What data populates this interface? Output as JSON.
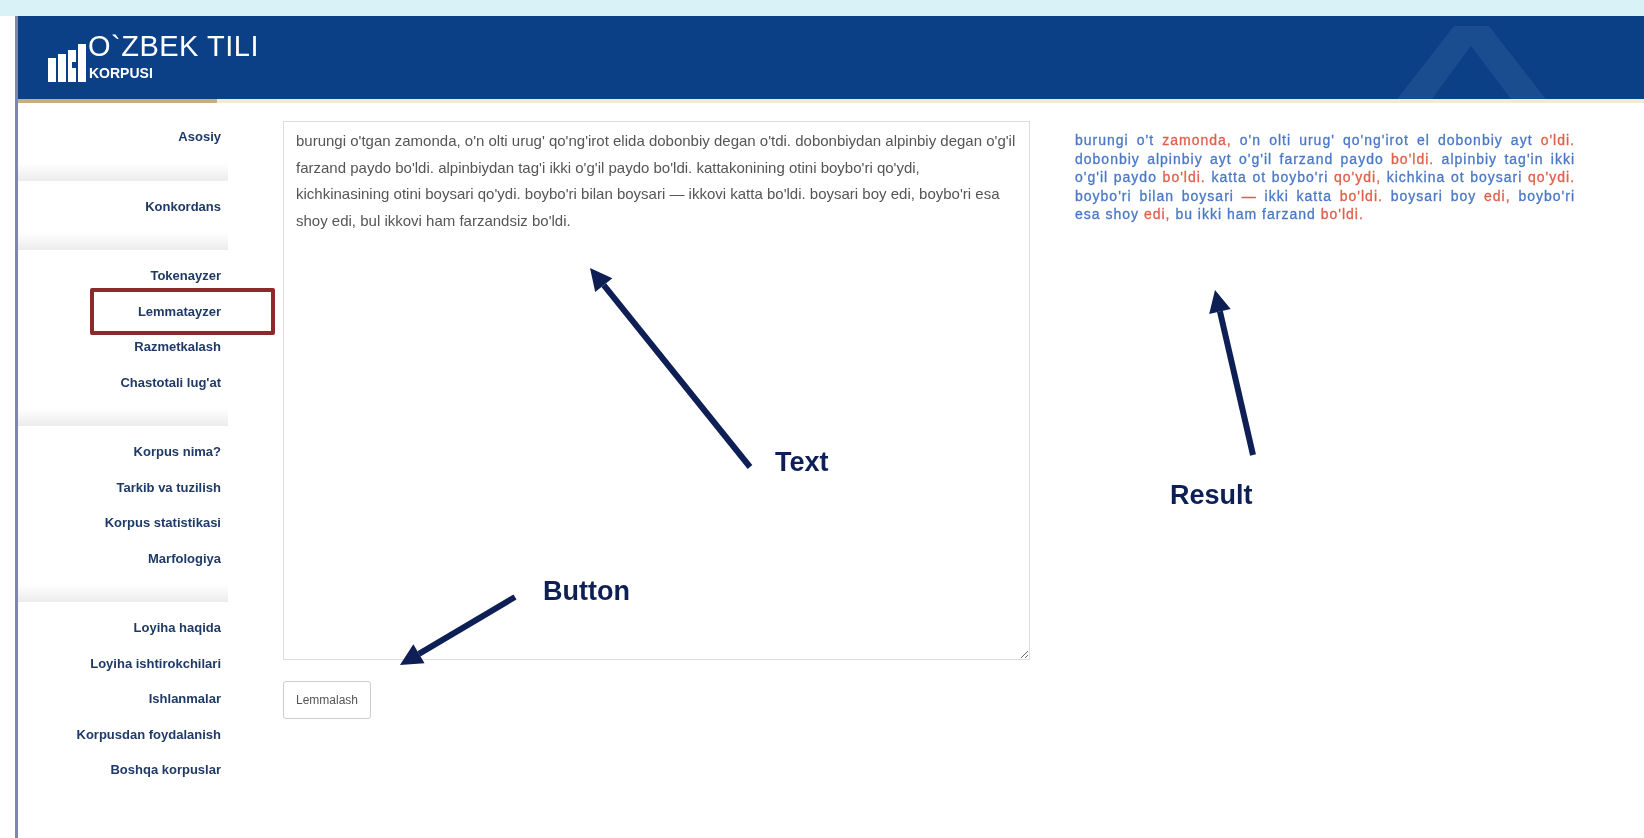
{
  "header": {
    "title": "O`ZBEK TILI",
    "subtitle": "KORPUSI"
  },
  "sidebar": {
    "groups": [
      {
        "items": [
          {
            "label": "Asosiy",
            "highlighted": false
          }
        ]
      },
      {
        "items": [
          {
            "label": "Konkordans",
            "highlighted": false
          }
        ]
      },
      {
        "items": [
          {
            "label": "Tokenayzer",
            "highlighted": false
          },
          {
            "label": "Lemmatayzer",
            "highlighted": true
          },
          {
            "label": "Razmetkalash",
            "highlighted": false
          },
          {
            "label": "Chastotali lug'at",
            "highlighted": false
          }
        ]
      },
      {
        "items": [
          {
            "label": "Korpus nima?",
            "highlighted": false
          },
          {
            "label": "Tarkib va tuzilish",
            "highlighted": false
          },
          {
            "label": "Korpus statistikasi",
            "highlighted": false
          },
          {
            "label": "Marfologiya",
            "highlighted": false
          }
        ]
      },
      {
        "items": [
          {
            "label": "Loyiha haqida",
            "highlighted": false
          },
          {
            "label": "Loyiha ishtirokchilari",
            "highlighted": false
          },
          {
            "label": "Ishlanmalar",
            "highlighted": false
          },
          {
            "label": "Korpusdan foydalanish",
            "highlighted": false
          },
          {
            "label": "Boshqa korpuslar",
            "highlighted": false
          }
        ]
      }
    ]
  },
  "text_input": {
    "value": "burungi o'tgan zamonda, o'n olti urug' qo'ng'irot elida dobonbiy degan o'tdi. dobonbiydan alpinbiy degan o'g'il farzand paydo bo'ldi. alpinbiydan tag'i ikki o'g'il paydo bo'ldi. kattakonining otini boybo'ri qo'ydi, kichkinasining otini boysari qo'ydi. boybo'ri bilan boysari — ikkovi katta bo'ldi. boysari boy edi, boybo'ri esa shoy edi, bul ikkovi ham farzandsiz bo'ldi."
  },
  "button": {
    "label": "Lemmalash"
  },
  "result": {
    "segments": [
      {
        "text": "burungi o't",
        "color": "#4a78c8"
      },
      {
        "text": "zamonda,",
        "color": "#e0604a"
      },
      {
        "text": "o'n olti urug' qo'ng'irot el dobonbiy ayt",
        "color": "#4a78c8"
      },
      {
        "text": "o'ldi.",
        "color": "#e0604a"
      },
      {
        "text": "dobonbiy alpinbiy ayt o'g'il farzand paydo",
        "color": "#4a78c8"
      },
      {
        "text": "bo'ldi.",
        "color": "#e0604a"
      },
      {
        "text": "alpinbiy tag'in ikki o'g'il paydo",
        "color": "#4a78c8"
      },
      {
        "text": "bo'ldi.",
        "color": "#e0604a"
      },
      {
        "text": "katta ot boybo'ri",
        "color": "#4a78c8"
      },
      {
        "text": "qo'ydi,",
        "color": "#e0604a"
      },
      {
        "text": "kichkina ot boysari",
        "color": "#4a78c8"
      },
      {
        "text": "qo'ydi.",
        "color": "#e0604a"
      },
      {
        "text": "boybo'ri bilan boysari",
        "color": "#4a78c8"
      },
      {
        "text": "—",
        "color": "#e0604a"
      },
      {
        "text": "ikki katta",
        "color": "#4a78c8"
      },
      {
        "text": "bo'ldi.",
        "color": "#e0604a"
      },
      {
        "text": "boysari boy",
        "color": "#4a78c8"
      },
      {
        "text": "edi,",
        "color": "#e0604a"
      },
      {
        "text": "boybo'ri esa shoy",
        "color": "#4a78c8"
      },
      {
        "text": "edi,",
        "color": "#e0604a"
      },
      {
        "text": "bu ikki ham farzand",
        "color": "#4a78c8"
      },
      {
        "text": "bo'ldi.",
        "color": "#e0604a"
      }
    ]
  },
  "annotations": [
    {
      "label": "Text"
    },
    {
      "label": "Result"
    },
    {
      "label": "Button"
    }
  ]
}
